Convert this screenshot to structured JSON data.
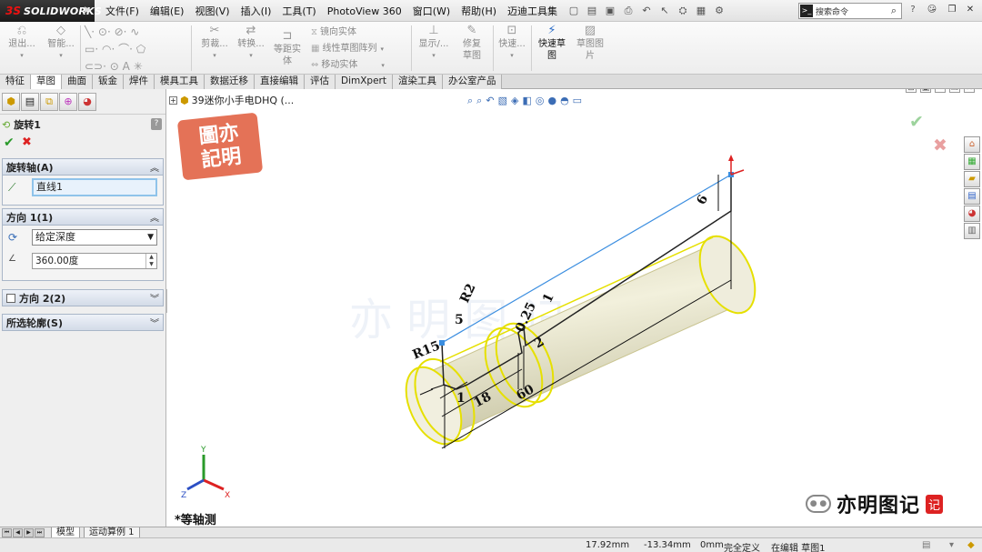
{
  "app": {
    "logo_ds": "3S",
    "logo_name": "SOLIDWORKS",
    "menus": [
      "文件(F)",
      "编辑(E)",
      "视图(V)",
      "插入(I)",
      "工具(T)",
      "PhotoView 360",
      "窗口(W)",
      "帮助(H)",
      "迈迪工具集"
    ],
    "search_placeholder": "搜索命令"
  },
  "ribbon": {
    "buttons": {
      "exit": "退出...",
      "smart": "智能...",
      "trim": "剪裁...",
      "convert": "转换...",
      "offset": "等距实体",
      "display": "显示/...",
      "repair": "修复草图",
      "quick": "快速...",
      "quick_sketch": "快速草图",
      "sketch_pic": "草图图片"
    },
    "small": {
      "mirror": "镜向实体",
      "linear_pattern": "线性草图阵列",
      "move": "移动实体"
    }
  },
  "tabs": [
    "特征",
    "草图",
    "曲面",
    "钣金",
    "焊件",
    "模具工具",
    "数据迁移",
    "直接编辑",
    "评估",
    "DimXpert",
    "渲染工具",
    "办公室产品"
  ],
  "active_tab": "草图",
  "property_manager": {
    "title": "旋转1",
    "help": "?",
    "axis_group": {
      "title": "旋转轴(A)",
      "value": "直线1"
    },
    "direction1": {
      "title": "方向 1(1)",
      "type": "给定深度",
      "angle": "360.00度"
    },
    "direction2": {
      "title": "方向 2(2)"
    },
    "contours": {
      "title": "所选轮廓(S)"
    }
  },
  "graphics": {
    "tree_item": "39迷你小手电DHQ  (...",
    "stamp_top": "圖亦",
    "stamp_bottom": "記明",
    "view_name": "*等轴测",
    "watermark": "亦明图记",
    "watermark_badge": "记",
    "dimensions": {
      "d6": "6",
      "r2": "R2",
      "d1a": "1",
      "d5": "5",
      "d025": "0.25",
      "r15": "R15",
      "d2": "2",
      "d1b": "1",
      "d18": "18",
      "d60": "60"
    },
    "triad": {
      "x": "X",
      "y": "Y",
      "z": "Z"
    }
  },
  "bottom_tabs": [
    "模型",
    "运动算例 1"
  ],
  "status": {
    "x": "17.92mm",
    "y": "-13.34mm",
    "z": "0mm",
    "defined": "完全定义",
    "editing": "在编辑 草图1"
  },
  "colors": {
    "cylinder": "#e8e6c8",
    "edge_highlight": "#f0e800",
    "axis_line": "#3b8ee0",
    "stamp": "#e05a3a"
  }
}
